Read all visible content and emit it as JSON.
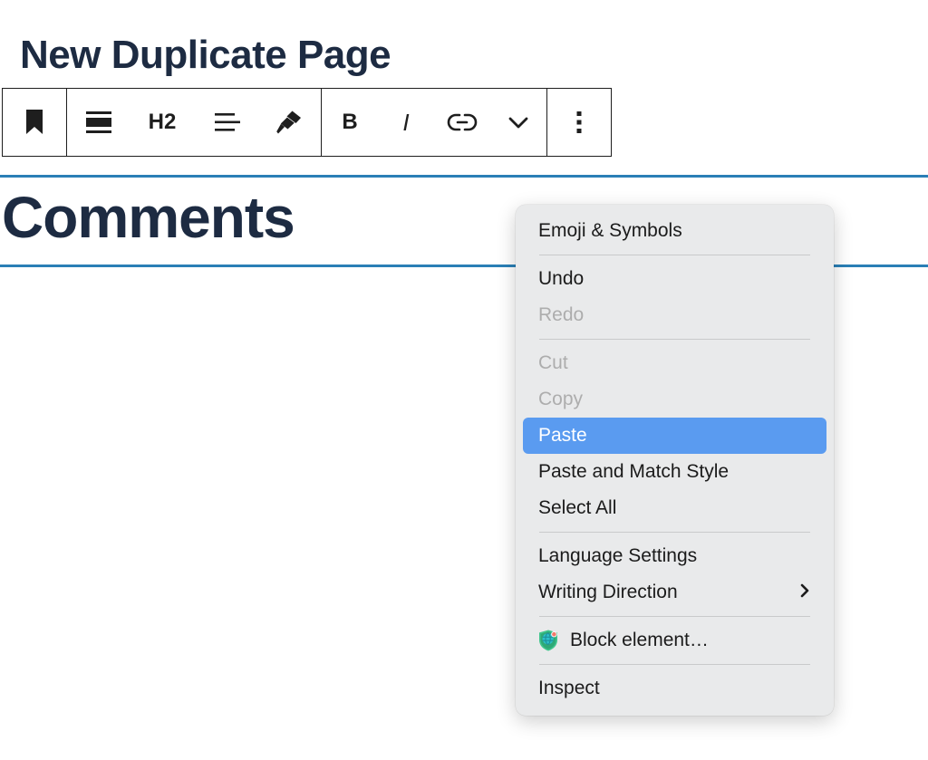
{
  "page": {
    "title": "New Duplicate Page"
  },
  "block": {
    "heading": "Comments",
    "selected_border_color": "#2a7fb6",
    "text_color": "#1d2b42"
  },
  "toolbar": {
    "groups": [
      {
        "name": "block-type-group",
        "buttons": [
          {
            "icon": "bookmark-icon",
            "label": "Block"
          }
        ]
      },
      {
        "name": "block-format-group",
        "buttons": [
          {
            "icon": "paragraph-block-icon",
            "label": "Change block type"
          },
          {
            "icon": "heading-level-text",
            "label": "H2"
          },
          {
            "icon": "align-text-icon",
            "label": "Align text"
          },
          {
            "icon": "highlighter-icon",
            "label": "Highlight"
          }
        ]
      },
      {
        "name": "inline-format-group",
        "buttons": [
          {
            "icon": "bold-text",
            "label": "B"
          },
          {
            "icon": "italic-text",
            "label": "I"
          },
          {
            "icon": "link-icon",
            "label": "Link"
          },
          {
            "icon": "chevron-down-icon",
            "label": "More rich text controls"
          }
        ]
      },
      {
        "name": "block-options-group",
        "buttons": [
          {
            "icon": "kebab-menu-icon",
            "label": "Options"
          }
        ]
      }
    ]
  },
  "context_menu": {
    "highlight_color": "#5a9bf0",
    "background_color": "#e9eaeb",
    "sections": [
      {
        "items": [
          {
            "label": "Emoji & Symbols",
            "state": "enabled"
          }
        ]
      },
      {
        "items": [
          {
            "label": "Undo",
            "state": "enabled"
          },
          {
            "label": "Redo",
            "state": "disabled"
          }
        ]
      },
      {
        "items": [
          {
            "label": "Cut",
            "state": "disabled"
          },
          {
            "label": "Copy",
            "state": "disabled"
          },
          {
            "label": "Paste",
            "state": "highlighted"
          },
          {
            "label": "Paste and Match Style",
            "state": "enabled"
          },
          {
            "label": "Select All",
            "state": "enabled"
          }
        ]
      },
      {
        "items": [
          {
            "label": "Language Settings",
            "state": "enabled"
          },
          {
            "label": "Writing Direction",
            "state": "enabled",
            "submenu_arrow": "›"
          }
        ]
      },
      {
        "items": [
          {
            "label": "Block element…",
            "state": "enabled",
            "icon": "shield-globe-icon"
          }
        ]
      },
      {
        "items": [
          {
            "label": "Inspect",
            "state": "enabled"
          }
        ]
      }
    ]
  }
}
